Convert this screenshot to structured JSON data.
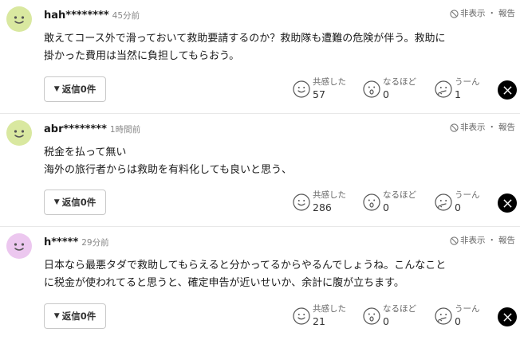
{
  "labels": {
    "report_hide": "非表示",
    "report_sep": "・",
    "report_report": "報告",
    "reply_caret": "▼",
    "reaction_kyokan": "共感した",
    "reaction_naruhodo": "なるほど",
    "reaction_un": "うーん"
  },
  "colors": {
    "avatar_face_0": "#d9e8a0",
    "avatar_face_1": "#d9e8a0",
    "avatar_face_2": "#ecc7ef"
  },
  "comments": [
    {
      "username": "hah********",
      "time": "45分前",
      "lines": [
        "敢えてコース外で滑っておいて救助要請するのか？救助隊も遭難の危険が伴う。救助に",
        "掛かった費用は当然に負担してもらおう。"
      ],
      "reply_label": "返信0件",
      "kyokan_count": "57",
      "naruhodo_count": "0",
      "un_count": "1"
    },
    {
      "username": "abr********",
      "time": "1時間前",
      "lines": [
        "税金を払って無い",
        "海外の旅行者からは救助を有料化しても良いと思う、"
      ],
      "reply_label": "返信0件",
      "kyokan_count": "286",
      "naruhodo_count": "0",
      "un_count": "0"
    },
    {
      "username": "h*****",
      "time": "29分前",
      "lines": [
        "日本なら最悪タダで救助してもらえると分かってるからやるんでしょうね。こんなこと",
        "に税金が使われてると思うと、確定申告が近いせいか、余計に腹が立ちます。"
      ],
      "reply_label": "返信0件",
      "kyokan_count": "21",
      "naruhodo_count": "0",
      "un_count": "0"
    }
  ]
}
